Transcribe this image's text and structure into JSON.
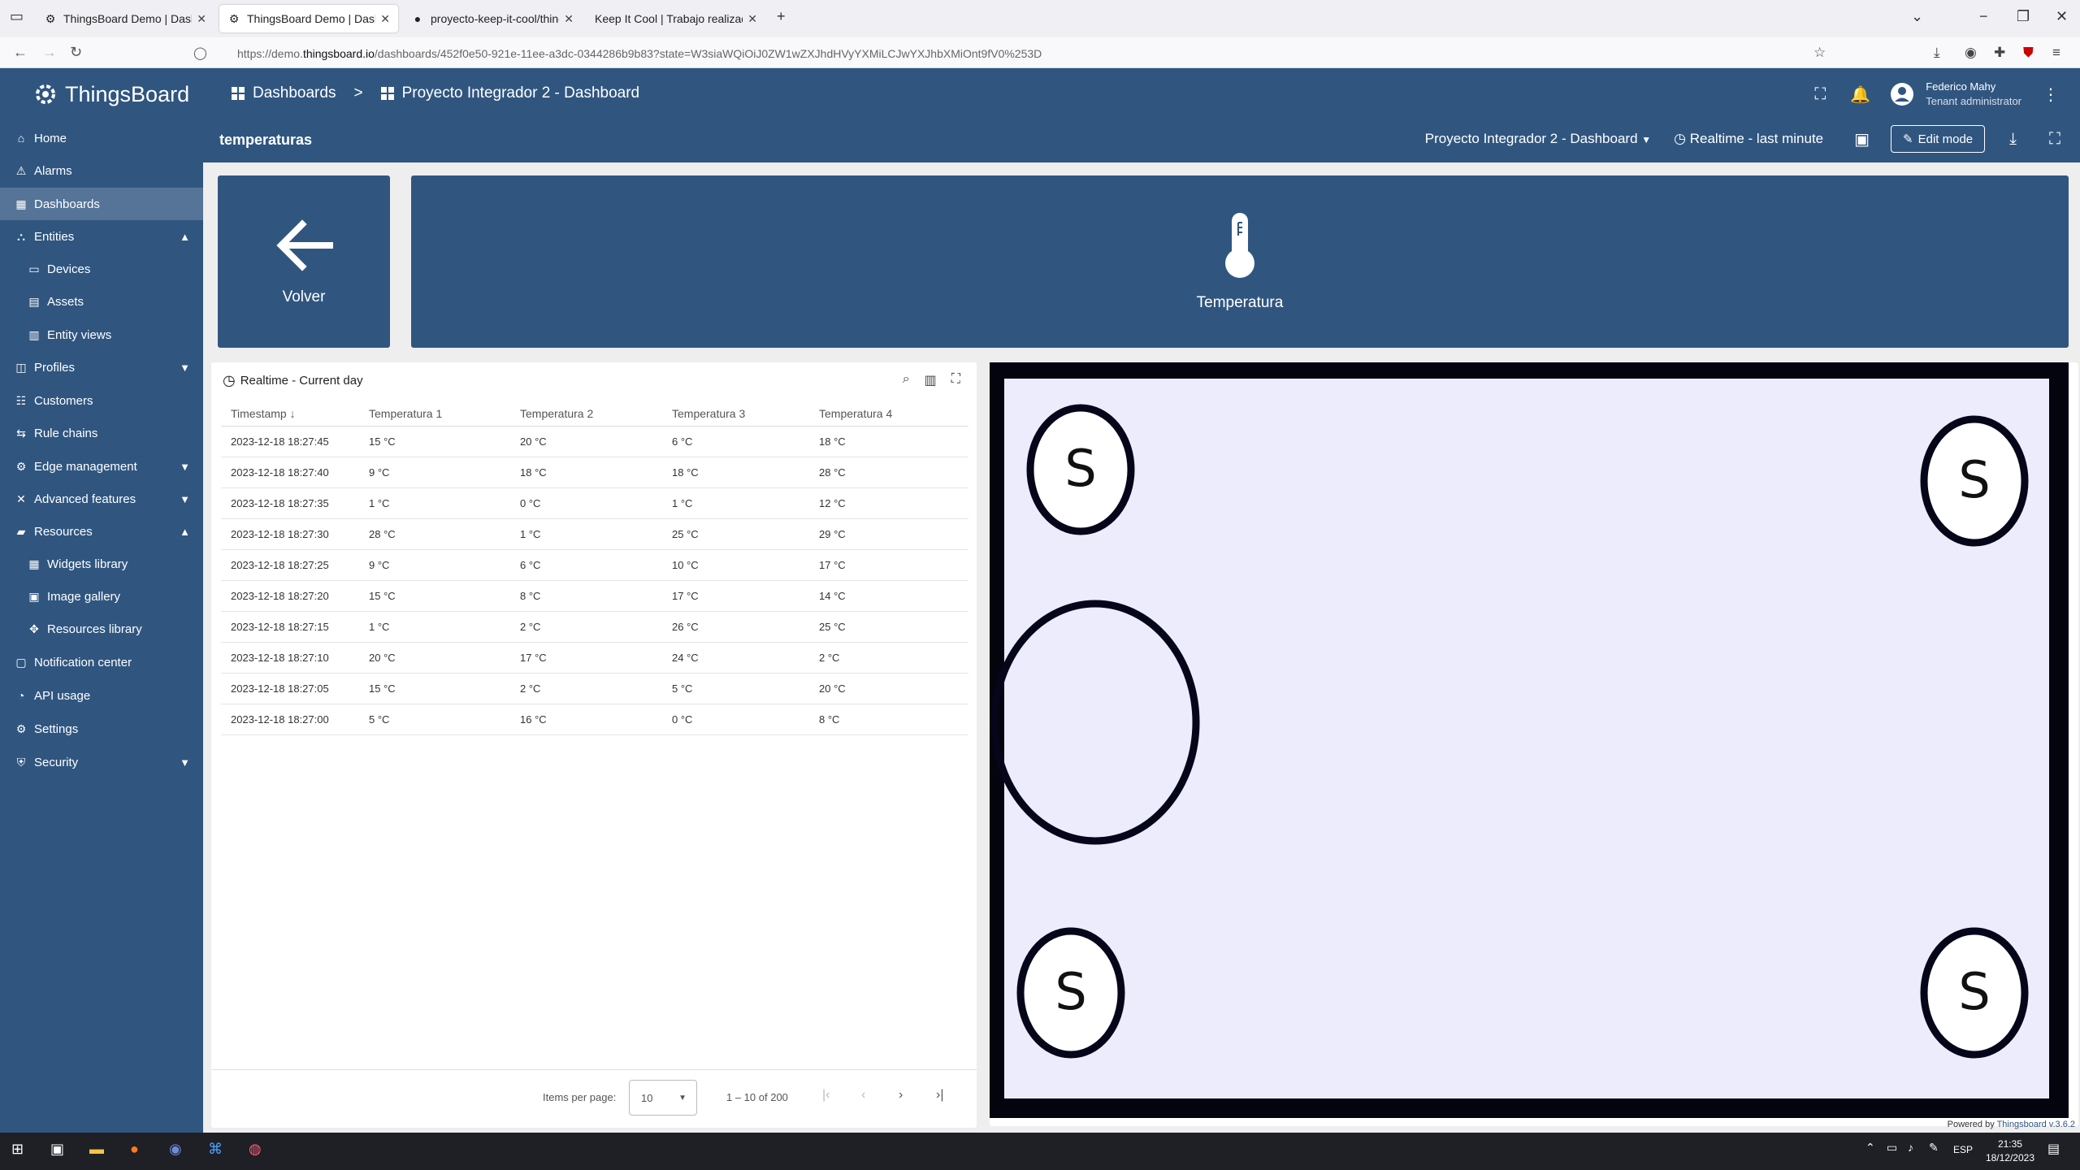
{
  "browser": {
    "tabs": [
      {
        "label": "ThingsBoard Demo | Dashboard",
        "active": false
      },
      {
        "label": "ThingsBoard Demo | Dashboard",
        "active": true
      },
      {
        "label": "proyecto-keep-it-cool/thingsb",
        "active": false
      },
      {
        "label": "Keep It Cool | Trabajo realizado en e",
        "active": false
      }
    ],
    "url_prefix": "https://demo.",
    "url_host": "thingsboard.io",
    "url_path": "/dashboards/452f0e50-921e-11ee-a3dc-0344286b9b83?state=W3siaWQiOiJ0ZW1wZXJhdHVyYXMiLCJwYXJhbXMiOnt9fV0%253D"
  },
  "app": {
    "logo": "ThingsBoard",
    "breadcrumb": [
      "Dashboards",
      "Proyecto Integrador 2 - Dashboard"
    ],
    "breadcrumb_sep": ">",
    "user_name": "Federico Mahy",
    "user_role": "Tenant administrator",
    "state_title": "temperaturas",
    "dashboard_select": "Proyecto Integrador 2 - Dashboard",
    "timewindow": "Realtime - last minute",
    "edit_mode": "Edit mode"
  },
  "sidebar": {
    "items": [
      {
        "label": "Home",
        "icon": "home-icon",
        "glyph": "⌂"
      },
      {
        "label": "Alarms",
        "icon": "alarm-icon",
        "glyph": "⚠"
      },
      {
        "label": "Dashboards",
        "icon": "dashboard-icon",
        "glyph": "▦"
      },
      {
        "label": "Entities",
        "icon": "entities-icon",
        "glyph": "⛬"
      },
      {
        "label": "Devices",
        "icon": "device-icon",
        "glyph": "▭"
      },
      {
        "label": "Assets",
        "icon": "asset-icon",
        "glyph": "▤"
      },
      {
        "label": "Entity views",
        "icon": "entity-view-icon",
        "glyph": "▥"
      },
      {
        "label": "Profiles",
        "icon": "profiles-icon",
        "glyph": "◫"
      },
      {
        "label": "Customers",
        "icon": "customers-icon",
        "glyph": "☷"
      },
      {
        "label": "Rule chains",
        "icon": "rule-chain-icon",
        "glyph": "⇆"
      },
      {
        "label": "Edge management",
        "icon": "edge-icon",
        "glyph": "⚙"
      },
      {
        "label": "Advanced features",
        "icon": "advanced-icon",
        "glyph": "✕"
      },
      {
        "label": "Resources",
        "icon": "folder-icon",
        "glyph": "▰"
      },
      {
        "label": "Widgets library",
        "icon": "widgets-icon",
        "glyph": "▦"
      },
      {
        "label": "Image gallery",
        "icon": "image-icon",
        "glyph": "▣"
      },
      {
        "label": "Resources library",
        "icon": "resources-icon",
        "glyph": "✥"
      },
      {
        "label": "Notification center",
        "icon": "notification-icon",
        "glyph": "▢"
      },
      {
        "label": "API usage",
        "icon": "api-usage-icon",
        "glyph": "◔"
      },
      {
        "label": "Settings",
        "icon": "settings-icon",
        "glyph": "⚙"
      },
      {
        "label": "Security",
        "icon": "security-icon",
        "glyph": "⛨"
      }
    ]
  },
  "widgets": {
    "back_label": "Volver",
    "temp_label": "Temperatura",
    "table": {
      "title": "Realtime - Current day",
      "columns": [
        "Timestamp",
        "Temperatura 1",
        "Temperatura 2",
        "Temperatura 3",
        "Temperatura 4"
      ],
      "rows": [
        [
          "2023-12-18 18:27:45",
          "15 °C",
          "20 °C",
          "6 °C",
          "18 °C"
        ],
        [
          "2023-12-18 18:27:40",
          "9 °C",
          "18 °C",
          "18 °C",
          "28 °C"
        ],
        [
          "2023-12-18 18:27:35",
          "1 °C",
          "0 °C",
          "1 °C",
          "12 °C"
        ],
        [
          "2023-12-18 18:27:30",
          "28 °C",
          "1 °C",
          "25 °C",
          "29 °C"
        ],
        [
          "2023-12-18 18:27:25",
          "9 °C",
          "6 °C",
          "10 °C",
          "17 °C"
        ],
        [
          "2023-12-18 18:27:20",
          "15 °C",
          "8 °C",
          "17 °C",
          "14 °C"
        ],
        [
          "2023-12-18 18:27:15",
          "1 °C",
          "2 °C",
          "26 °C",
          "25 °C"
        ],
        [
          "2023-12-18 18:27:10",
          "20 °C",
          "17 °C",
          "24 °C",
          "2 °C"
        ],
        [
          "2023-12-18 18:27:05",
          "15 °C",
          "2 °C",
          "5 °C",
          "20 °C"
        ],
        [
          "2023-12-18 18:27:00",
          "5 °C",
          "16 °C",
          "0 °C",
          "8 °C"
        ]
      ],
      "items_per_page_label": "Items per page:",
      "items_per_page": "10",
      "range": "1 – 10 of 200"
    },
    "sensor_letter": "S",
    "powered_by": "Powered by",
    "powered_link": "Thingsboard v.3.6.2"
  },
  "taskbar": {
    "lang": "ESP",
    "time": "21:35",
    "date": "18/12/2023"
  }
}
